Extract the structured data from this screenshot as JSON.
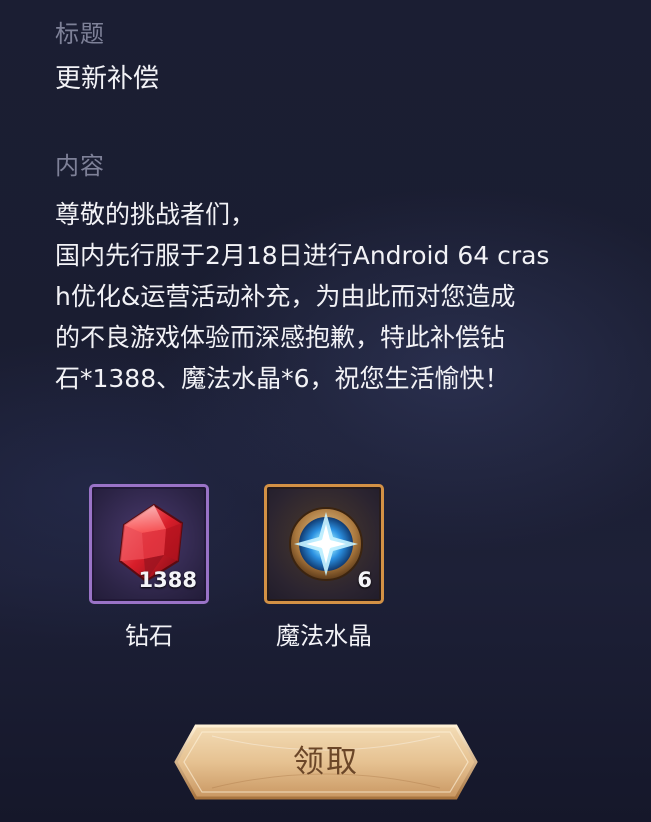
{
  "title": {
    "label": "标题",
    "value": "更新补偿"
  },
  "content": {
    "label": "内容",
    "lines": [
      "尊敬的挑战者们，",
      "国内先行服于2月18日进行Android 64 cras",
      "h优化&运营活动补充，为由此而对您造成",
      "的不良游戏体验而深感抱歉，特此补偿钻",
      "石*1388、魔法水晶*6，祝您生活愉快！"
    ]
  },
  "rewards": [
    {
      "name": "钻石",
      "count": "1388",
      "icon": "red-gem-icon",
      "frame_color": "#9a73c7"
    },
    {
      "name": "魔法水晶",
      "count": "6",
      "icon": "magic-crystal-icon",
      "frame_color": "#d39145"
    }
  ],
  "claim_button": {
    "label": "领取"
  },
  "colors": {
    "background": "#1b1e33",
    "label": "#7e8198",
    "text": "#f2f2f6",
    "button_gold": "#e9c79a",
    "button_text": "#6b4628"
  }
}
